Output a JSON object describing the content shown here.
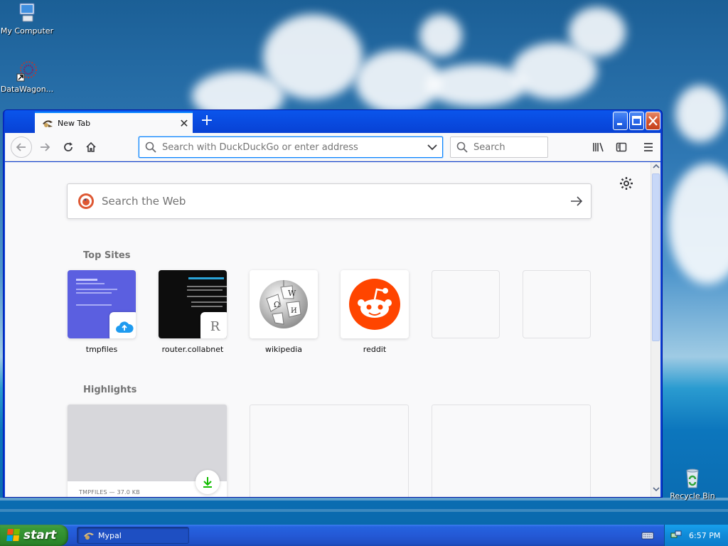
{
  "desktop": {
    "icons": [
      {
        "label": "My Computer"
      },
      {
        "label": "DataWagon..."
      },
      {
        "label": "Recycle Bin"
      }
    ]
  },
  "browser": {
    "tab": {
      "title": "New Tab",
      "close_glyph": "✕"
    },
    "new_tab_glyph": "+",
    "window_buttons": {
      "minimize": "minimize-icon",
      "maximize": "maximize-icon",
      "close": "close-icon"
    },
    "url_placeholder": "Search with DuckDuckGo or enter address",
    "search_placeholder": "Search",
    "toolbar_icons": [
      "back-icon",
      "forward-icon",
      "reload-icon",
      "home-icon",
      "library-icon",
      "sidebar-icon",
      "menu-icon"
    ]
  },
  "newtab": {
    "web_search_placeholder": "Search the Web",
    "top_sites_title": "Top Sites",
    "top_sites": [
      {
        "label": "tmpfiles",
        "badge": "cloud-icon"
      },
      {
        "label": "router.collabnet",
        "badge": "R"
      },
      {
        "label": "wikipedia"
      },
      {
        "label": "reddit"
      },
      {
        "label": ""
      },
      {
        "label": ""
      }
    ],
    "highlights_title": "Highlights",
    "highlights": [
      {
        "meta": "TMPFILES — 37.0 KB",
        "action": "download-icon"
      },
      {
        "meta": ""
      },
      {
        "meta": ""
      }
    ]
  },
  "taskbar": {
    "start_label": "start",
    "task_label": "Mypal",
    "clock": "6:57 PM"
  },
  "colors": {
    "accent": "#0a84ff",
    "reddit": "#ff4500",
    "tmpfiles_tile": "#5b5fe0",
    "download_green": "#12bc00"
  }
}
